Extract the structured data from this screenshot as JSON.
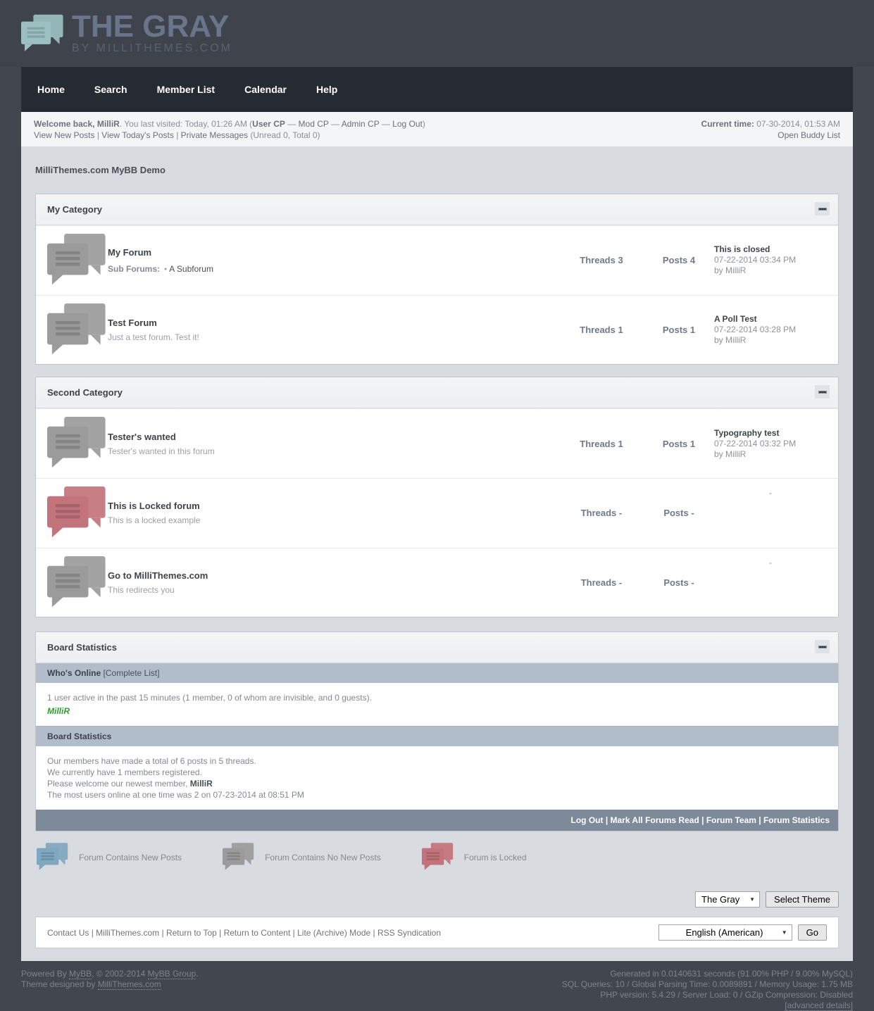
{
  "logo": {
    "title": "THE GRAY",
    "subtitle": "BY MILLITHEMES.COM"
  },
  "nav": {
    "items": [
      "Home",
      "Search",
      "Member List",
      "Calendar",
      "Help"
    ]
  },
  "sep": {
    "pipe": " | ",
    "dash": " — "
  },
  "welcome": {
    "greeting": "Welcome back, MilliR",
    "visited": ". You last visited: Today, 01:26 AM (",
    "user_cp": "User CP",
    "mod_cp": "Mod CP",
    "admin_cp": "Admin CP",
    "log_out": "Log Out",
    "close": ")",
    "view_new": "View New Posts",
    "view_today": "View Today's Posts",
    "pm": "Private Messages",
    "pm_counts": "(Unread 0, Total 0)",
    "current_time_label": "Current time:",
    "current_time": "07-30-2014, 01:53 AM",
    "buddy_list": "Open Buddy List"
  },
  "page_title": "MilliThemes.com MyBB Demo",
  "labels": {
    "threads": "Threads",
    "posts": "Posts",
    "sub_forums": "Sub Forums:",
    "bullet": "●"
  },
  "colors": {
    "icon_new": "#7fa7bf",
    "icon_no_new": "#9b9b9b",
    "icon_locked": "#c2737b",
    "online_user": "#2e9e2e"
  },
  "categories": [
    {
      "title": "My Category",
      "forums": [
        {
          "name": "My Forum",
          "subforum": "A Subforum",
          "threads": "3",
          "posts": "4",
          "last_title": "This is closed",
          "last_date": "07-22-2014 03:34 PM",
          "last_by": "by MilliR"
        },
        {
          "name": "Test Forum",
          "desc": "Just a test forum. Test it!",
          "threads": "1",
          "posts": "1",
          "last_title": "A Poll Test",
          "last_date": "07-22-2014 03:28 PM",
          "last_by": "by MilliR"
        }
      ]
    },
    {
      "title": "Second Category",
      "forums": [
        {
          "name": "Tester's wanted",
          "desc": "Tester's wanted in this forum",
          "threads": "1",
          "posts": "1",
          "last_title": "Typography test",
          "last_date": "07-22-2014 03:32 PM",
          "last_by": "by MilliR"
        },
        {
          "name": "This is Locked forum",
          "desc": "This is a locked example",
          "threads": "-",
          "posts": "-",
          "last_dash": "-"
        },
        {
          "name": "Go to MilliThemes.com",
          "desc": "This redirects you",
          "threads": "-",
          "posts": "-",
          "last_dash": "-"
        }
      ]
    }
  ],
  "board": {
    "title": "Board Statistics",
    "whos_online": "Who's Online",
    "complete_list": "[Complete List]",
    "online_line": "1 user active in the past 15 minutes (1 member, 0 of whom are invisible, and 0 guests).",
    "online_user": "MilliR",
    "stats_title": "Board Statistics",
    "line1": "Our members have made a total of 6 posts in 5 threads.",
    "line2": "We currently have 1 members registered.",
    "line3": "Please welcome our newest member, ",
    "newest": "MilliR",
    "line4": "The most users online at one time was 2 on 07-23-2014 at 08:51 PM",
    "footer": {
      "log_out": "Log Out",
      "mark_read": "Mark All Forums Read",
      "team": "Forum Team",
      "stats": "Forum Statistics"
    }
  },
  "legend": {
    "new_posts": "Forum Contains New Posts",
    "no_new_posts": "Forum Contains No New Posts",
    "locked": "Forum is Locked"
  },
  "theme_select": {
    "selected": "The Gray",
    "button": "Select Theme"
  },
  "footer_strip": {
    "links": [
      "Contact Us",
      "MilliThemes.com",
      "Return to Top",
      "Return to Content",
      "Lite (Archive) Mode",
      "RSS Syndication"
    ],
    "language": "English (American)",
    "go": "Go"
  },
  "page_footer": {
    "powered_prefix": "Powered By ",
    "mybb": "MyBB",
    "mid": ", © 2002-2014 ",
    "mybb_group": "MyBB Group",
    "dot": ".",
    "theme_prefix": "Theme designed by ",
    "millithemes": "MilliThemes.com",
    "gen_line1": "Generated in 0.0140631 seconds (91.00% PHP / 9.00% MySQL)",
    "gen_line2": "SQL Queries: 10 / Global Parsing Time: 0.0089891 / Memory Usage: 1.75 MB",
    "gen_line3": "PHP version: 5.4.29 / Server Load: 0 / GZip Compression: Disabled",
    "advanced": "[advanced details]"
  }
}
